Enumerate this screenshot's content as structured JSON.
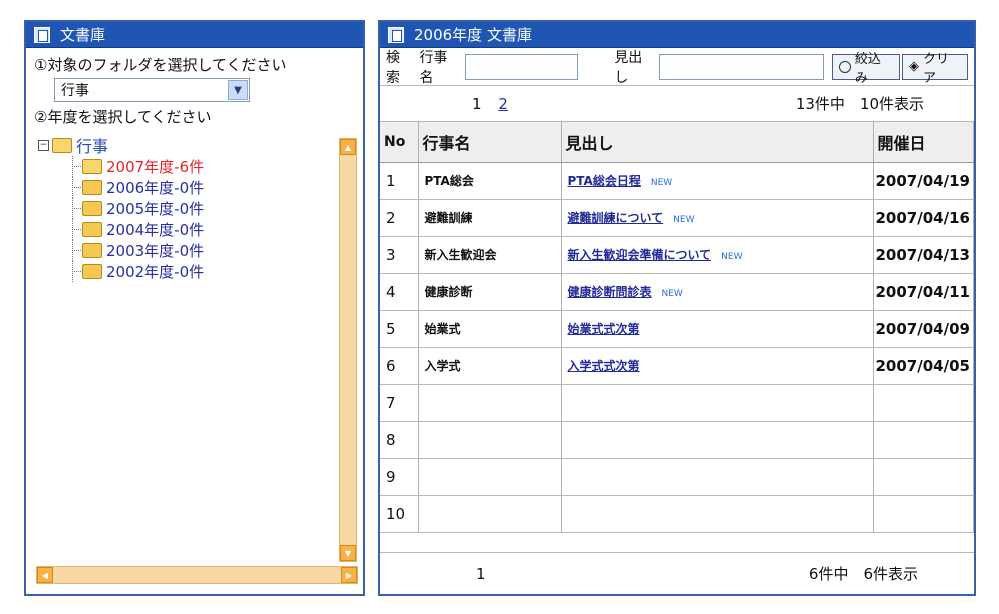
{
  "left": {
    "title": "文書庫",
    "step1": "①対象のフォルダを選択してください",
    "select_value": "行事",
    "step2": "②年度を選択してください",
    "tree_root": "行事",
    "tree_items": [
      {
        "label": "2007年度-6件",
        "active": true
      },
      {
        "label": "2006年度-0件",
        "active": false
      },
      {
        "label": "2005年度-0件",
        "active": false
      },
      {
        "label": "2004年度-0件",
        "active": false
      },
      {
        "label": "2003年度-0件",
        "active": false
      },
      {
        "label": "2002年度-0件",
        "active": false
      }
    ]
  },
  "right": {
    "title": "2006年度 文書庫",
    "search": {
      "label": "検索",
      "event_label": "行事名",
      "heading_label": "見出し",
      "filter_button": "絞込み",
      "clear_button": "クリア"
    },
    "pager": {
      "page1": "1",
      "page2": "2",
      "count": "13件中　10件表示"
    },
    "columns": [
      "No",
      "行事名",
      "見出し",
      "開催日"
    ],
    "rows": [
      {
        "no": "1",
        "event": "PTA総会",
        "heading": "PTA総会日程",
        "new": "NEW",
        "date": "2007/04/19"
      },
      {
        "no": "2",
        "event": "避難訓練",
        "heading": "避難訓練について",
        "new": "NEW",
        "date": "2007/04/16"
      },
      {
        "no": "3",
        "event": "新入生歓迎会",
        "heading": "新入生歓迎会準備について",
        "new": "NEW",
        "date": "2007/04/13"
      },
      {
        "no": "4",
        "event": "健康診断",
        "heading": "健康診断問診表",
        "new": "NEW",
        "date": "2007/04/11"
      },
      {
        "no": "5",
        "event": "始業式",
        "heading": "始業式式次第",
        "new": "",
        "date": "2007/04/09"
      },
      {
        "no": "6",
        "event": "入学式",
        "heading": "入学式式次第",
        "new": "",
        "date": "2007/04/05"
      },
      {
        "no": "7",
        "event": "",
        "heading": "",
        "new": "",
        "date": ""
      },
      {
        "no": "8",
        "event": "",
        "heading": "",
        "new": "",
        "date": ""
      },
      {
        "no": "9",
        "event": "",
        "heading": "",
        "new": "",
        "date": ""
      },
      {
        "no": "10",
        "event": "",
        "heading": "",
        "new": "",
        "date": ""
      }
    ],
    "footer": {
      "page": "1",
      "count": "6件中　6件表示"
    }
  },
  "colors": {
    "titlebar": "#1f56b4",
    "active_tree": "#e8242b",
    "link": "#222b9a",
    "scrollbar": "#f9b24a"
  }
}
